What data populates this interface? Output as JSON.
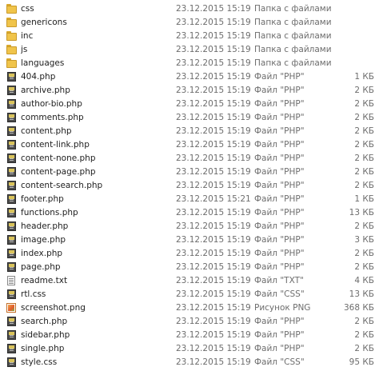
{
  "files": [
    {
      "name": "css",
      "date": "23.12.2015 15:19",
      "type": "Папка с файлами",
      "size": "",
      "icon": "folder-icon"
    },
    {
      "name": "genericons",
      "date": "23.12.2015 15:19",
      "type": "Папка с файлами",
      "size": "",
      "icon": "folder-icon"
    },
    {
      "name": "inc",
      "date": "23.12.2015 15:19",
      "type": "Папка с файлами",
      "size": "",
      "icon": "folder-icon"
    },
    {
      "name": "js",
      "date": "23.12.2015 15:19",
      "type": "Папка с файлами",
      "size": "",
      "icon": "folder-icon"
    },
    {
      "name": "languages",
      "date": "23.12.2015 15:19",
      "type": "Папка с файлами",
      "size": "",
      "icon": "folder-icon"
    },
    {
      "name": "404.php",
      "date": "23.12.2015 15:19",
      "type": "Файл \"PHP\"",
      "size": "1 КБ",
      "icon": "php-file-icon"
    },
    {
      "name": "archive.php",
      "date": "23.12.2015 15:19",
      "type": "Файл \"PHP\"",
      "size": "2 КБ",
      "icon": "php-file-icon"
    },
    {
      "name": "author-bio.php",
      "date": "23.12.2015 15:19",
      "type": "Файл \"PHP\"",
      "size": "2 КБ",
      "icon": "php-file-icon"
    },
    {
      "name": "comments.php",
      "date": "23.12.2015 15:19",
      "type": "Файл \"PHP\"",
      "size": "2 КБ",
      "icon": "php-file-icon"
    },
    {
      "name": "content.php",
      "date": "23.12.2015 15:19",
      "type": "Файл \"PHP\"",
      "size": "2 КБ",
      "icon": "php-file-icon"
    },
    {
      "name": "content-link.php",
      "date": "23.12.2015 15:19",
      "type": "Файл \"PHP\"",
      "size": "2 КБ",
      "icon": "php-file-icon"
    },
    {
      "name": "content-none.php",
      "date": "23.12.2015 15:19",
      "type": "Файл \"PHP\"",
      "size": "2 КБ",
      "icon": "php-file-icon"
    },
    {
      "name": "content-page.php",
      "date": "23.12.2015 15:19",
      "type": "Файл \"PHP\"",
      "size": "2 КБ",
      "icon": "php-file-icon"
    },
    {
      "name": "content-search.php",
      "date": "23.12.2015 15:19",
      "type": "Файл \"PHP\"",
      "size": "2 КБ",
      "icon": "php-file-icon"
    },
    {
      "name": "footer.php",
      "date": "23.12.2015 15:21",
      "type": "Файл \"PHP\"",
      "size": "1 КБ",
      "icon": "php-file-icon"
    },
    {
      "name": "functions.php",
      "date": "23.12.2015 15:19",
      "type": "Файл \"PHP\"",
      "size": "13 КБ",
      "icon": "php-file-icon"
    },
    {
      "name": "header.php",
      "date": "23.12.2015 15:19",
      "type": "Файл \"PHP\"",
      "size": "2 КБ",
      "icon": "php-file-icon"
    },
    {
      "name": "image.php",
      "date": "23.12.2015 15:19",
      "type": "Файл \"PHP\"",
      "size": "3 КБ",
      "icon": "php-file-icon"
    },
    {
      "name": "index.php",
      "date": "23.12.2015 15:19",
      "type": "Файл \"PHP\"",
      "size": "2 КБ",
      "icon": "php-file-icon"
    },
    {
      "name": "page.php",
      "date": "23.12.2015 15:19",
      "type": "Файл \"PHP\"",
      "size": "2 КБ",
      "icon": "php-file-icon"
    },
    {
      "name": "readme.txt",
      "date": "23.12.2015 15:19",
      "type": "Файл \"TXT\"",
      "size": "4 КБ",
      "icon": "text-file-icon"
    },
    {
      "name": "rtl.css",
      "date": "23.12.2015 15:19",
      "type": "Файл \"CSS\"",
      "size": "13 КБ",
      "icon": "css-file-icon"
    },
    {
      "name": "screenshot.png",
      "date": "23.12.2015 15:19",
      "type": "Рисунок PNG",
      "size": "368 КБ",
      "icon": "image-file-icon"
    },
    {
      "name": "search.php",
      "date": "23.12.2015 15:19",
      "type": "Файл \"PHP\"",
      "size": "2 КБ",
      "icon": "php-file-icon"
    },
    {
      "name": "sidebar.php",
      "date": "23.12.2015 15:19",
      "type": "Файл \"PHP\"",
      "size": "2 КБ",
      "icon": "php-file-icon"
    },
    {
      "name": "single.php",
      "date": "23.12.2015 15:19",
      "type": "Файл \"PHP\"",
      "size": "2 КБ",
      "icon": "php-file-icon"
    },
    {
      "name": "style.css",
      "date": "23.12.2015 15:19",
      "type": "Файл \"CSS\"",
      "size": "95 КБ",
      "icon": "css-file-icon"
    }
  ]
}
